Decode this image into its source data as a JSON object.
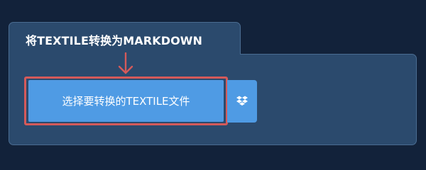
{
  "panel": {
    "title": "将TEXTILE转换为MARKDOWN"
  },
  "upload": {
    "select_label": "选择要转换的TEXTILE文件",
    "dropbox_icon": "dropbox-icon"
  },
  "colors": {
    "background": "#12223a",
    "panel": "#2b4a6d",
    "button": "#4f9be4",
    "highlight": "#d55a5a"
  }
}
